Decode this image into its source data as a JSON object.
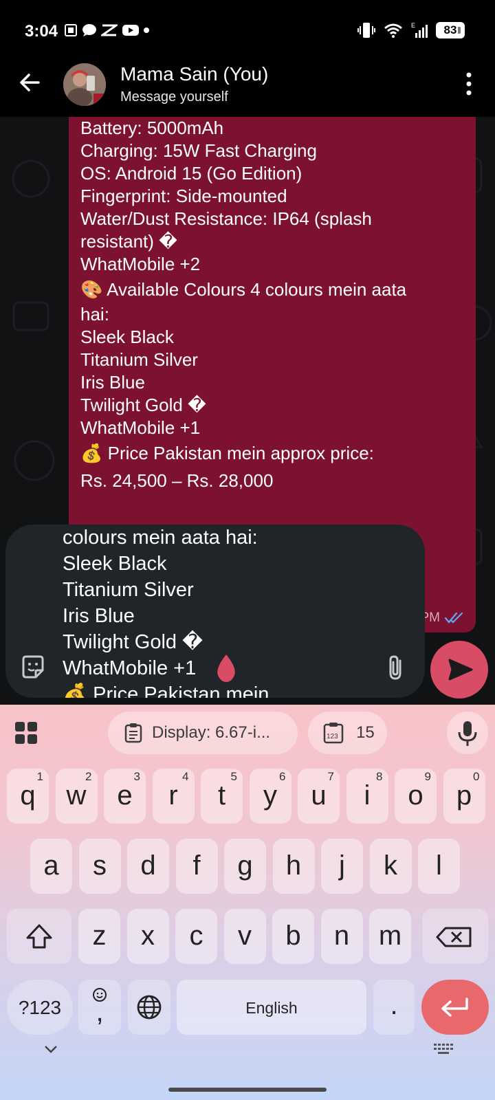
{
  "status_bar": {
    "time": "3:04",
    "battery": "83"
  },
  "header": {
    "title": "Mama Sain (You)",
    "subtitle": "Message yourself"
  },
  "message": {
    "lines": [
      "Battery: 5000mAh",
      "Charging: 15W Fast Charging",
      "OS: Android 15 (Go Edition)",
      "Fingerprint: Side-mounted",
      "Water/Dust Resistance: IP64 (splash",
      "resistant) �",
      "WhatMobile +2",
      "🎨 Available Colours 4 colours mein aata",
      "hai:",
      "Sleek Black",
      "Titanium Silver",
      "Iris Blue",
      "Twilight Gold �",
      "WhatMobile +1",
      "💰 Price Pakistan mein approx price:",
      "Rs. 24,500 – Rs. 28,000"
    ],
    "time": "2:57 PM"
  },
  "composer": {
    "lines": [
      "colours mein aata hai:",
      "Sleek Black",
      "Titanium Silver",
      "Iris Blue",
      "Twilight Gold �",
      "WhatMobile +1",
      "💰 Price Pakistan mein"
    ]
  },
  "keyboard": {
    "suggestion_1": "Display: 6.67-i...",
    "suggestion_2": "15",
    "row1": [
      {
        "k": "q",
        "h": "1"
      },
      {
        "k": "w",
        "h": "2"
      },
      {
        "k": "e",
        "h": "3"
      },
      {
        "k": "r",
        "h": "4"
      },
      {
        "k": "t",
        "h": "5"
      },
      {
        "k": "y",
        "h": "6"
      },
      {
        "k": "u",
        "h": "7"
      },
      {
        "k": "i",
        "h": "8"
      },
      {
        "k": "o",
        "h": "9"
      },
      {
        "k": "p",
        "h": "0"
      }
    ],
    "row2": [
      "a",
      "s",
      "d",
      "f",
      "g",
      "h",
      "j",
      "k",
      "l"
    ],
    "row3": [
      "z",
      "x",
      "c",
      "v",
      "b",
      "n",
      "m"
    ],
    "sym_label": "?123",
    "comma_label": ",",
    "space_label": "English",
    "period_label": "."
  },
  "colors": {
    "bubble": "#7d1230",
    "send": "#d84c66",
    "enter": "#e8686b"
  }
}
